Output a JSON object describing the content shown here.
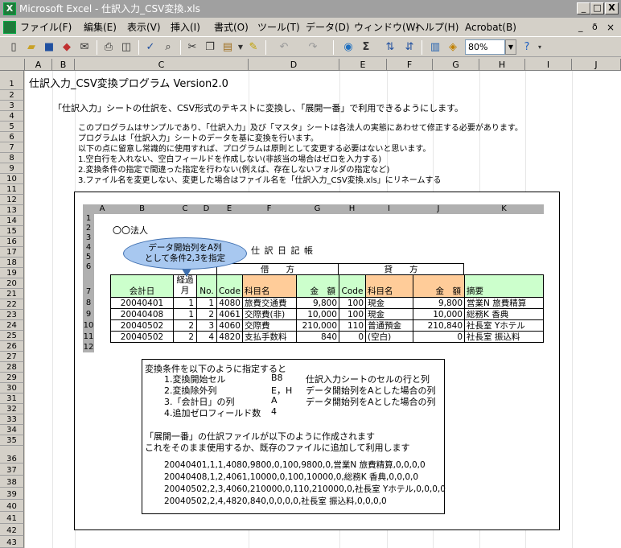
{
  "window": {
    "app_icon": "X",
    "title": "Microsoft Excel - 仕訳入力_CSV変換.xls",
    "minimize": "_",
    "maximize": "□",
    "close": "X"
  },
  "menu": [
    "ファイル(F)",
    "編集(E)",
    "表示(V)",
    "挿入(I)",
    "書式(O)",
    "ツール(T)",
    "データ(D)",
    "ウィンドウ(W)",
    "ヘルプ(H)",
    "Acrobat(B)"
  ],
  "menu_right": {
    "minimize": "_",
    "restore": "ð",
    "close": "×"
  },
  "toolbar": {
    "zoom": "80%",
    "sum": "Σ"
  },
  "columns": [
    "A",
    "B",
    "C",
    "D",
    "E",
    "F",
    "G",
    "H",
    "I",
    "J"
  ],
  "rows": [
    "1",
    "2",
    "3",
    "4",
    "5",
    "6",
    "7",
    "8",
    "9",
    "10",
    "11",
    "12",
    "13",
    "14",
    "15",
    "16",
    "17",
    "18",
    "19",
    "20",
    "21",
    "22",
    "23",
    "24",
    "25",
    "26",
    "27",
    "28",
    "29",
    "30",
    "31",
    "32",
    "33",
    "34",
    "35",
    "36",
    "37",
    "38",
    "39",
    "40",
    "41",
    "42",
    "43"
  ],
  "sheet": {
    "title": "仕訳入力_CSV変換プログラム Version2.0",
    "intro": "「仕訳入力」シートの仕訳を、CSV形式のテキストに変換し、「展開一番」で利用できるようにします。",
    "notes": [
      "このプログラムはサンプルであり、「仕訳入力」及び「マスタ」シートは各法人の実態にあわせて修正する必要があります。",
      "プログラムは「仕訳入力」シートのデータを基に変換を行います。",
      "以下の点に留意し常識的に使用すれば、プログラムは原則として変更する必要はないと思います。",
      "1.空白行を入れない、空白フィールドを作成しない(非該当の場合はゼロを入力する)",
      "2.変換条件の指定で間違った指定を行わない(例えば、存在しないフォルダの指定など)",
      "3.ファイル名を変更しない、変更した場合はファイル名を「仕訳入力_CSV変換.xls」にリネームする"
    ]
  },
  "example": {
    "columns": [
      "A",
      "B",
      "C",
      "D",
      "E",
      "F",
      "G",
      "H",
      "I",
      "J",
      "K"
    ],
    "rows": [
      "1",
      "2",
      "3",
      "4",
      "5",
      "6",
      "",
      "7",
      "8",
      "9",
      "10",
      "11",
      "12"
    ],
    "company": "〇〇法人",
    "callout": [
      "データ開始列をA列",
      "として条件2,3を指定"
    ],
    "journal_title": "仕 訳 日 記 帳",
    "debit": "借　　方",
    "credit": "貸　　方",
    "headers": {
      "date": "会計日",
      "month": "経過月",
      "no": "No.",
      "code": "Code",
      "account": "科目名",
      "amount": "金　額",
      "code2": "Code",
      "account2": "科目名",
      "amount2": "金　額",
      "summary": "摘要"
    },
    "entries": [
      {
        "date": "20040401",
        "month": "1",
        "no": "1",
        "code": "4080",
        "account": "旅費交通費",
        "amount": "9,800",
        "code2": "100",
        "account2": "現金",
        "amount2": "9,800",
        "summary": "営業N 旅費精算"
      },
      {
        "date": "20040408",
        "month": "1",
        "no": "2",
        "code": "4061",
        "account": "交際費(非)",
        "amount": "10,000",
        "code2": "100",
        "account2": "現金",
        "amount2": "10,000",
        "summary": "総務K 香典"
      },
      {
        "date": "20040502",
        "month": "2",
        "no": "3",
        "code": "4060",
        "account": "交際費",
        "amount": "210,000",
        "code2": "110",
        "account2": "普通預金",
        "amount2": "210,840",
        "summary": "社長室 Yホテル"
      },
      {
        "date": "20040502",
        "month": "2",
        "no": "4",
        "code": "4820",
        "account": "支払手数料",
        "amount": "840",
        "code2": "0",
        "account2": "(空白)",
        "amount2": "0",
        "summary": "社長室 振込料"
      }
    ],
    "conditions_intro": "変換条件を以下のように指定すると",
    "conditions": [
      {
        "label": "1.変換開始セル",
        "value": "B8",
        "desc": "仕訳入力シートのセルの行と列"
      },
      {
        "label": "2.変換除外列",
        "value": "E，H",
        "desc": "データ開始列をAとした場合の列"
      },
      {
        "label": "3.「会計日」の列",
        "value": "A",
        "desc": "データ開始列をAとした場合の列"
      },
      {
        "label": "4.追加ゼロフィールド数",
        "value": "4",
        "desc": ""
      }
    ],
    "result_intro1": "「展開一番」の仕訳ファイルが以下のように作成されます",
    "result_intro2": "これをそのまま使用するか、既存のファイルに追加して利用します",
    "csv": [
      "20040401,1,1,4080,9800,0,100,9800,0,営業N 旅費精算,0,0,0,0",
      "20040408,1,2,4061,10000,0,100,10000,0,総務K 香典,0,0,0,0",
      "20040502,2,3,4060,210000,0,110,210000,0,社長室 Yホテル,0,0,0,0",
      "20040502,2,4,4820,840,0,0,0,0,社長室 振込料,0,0,0,0"
    ]
  }
}
